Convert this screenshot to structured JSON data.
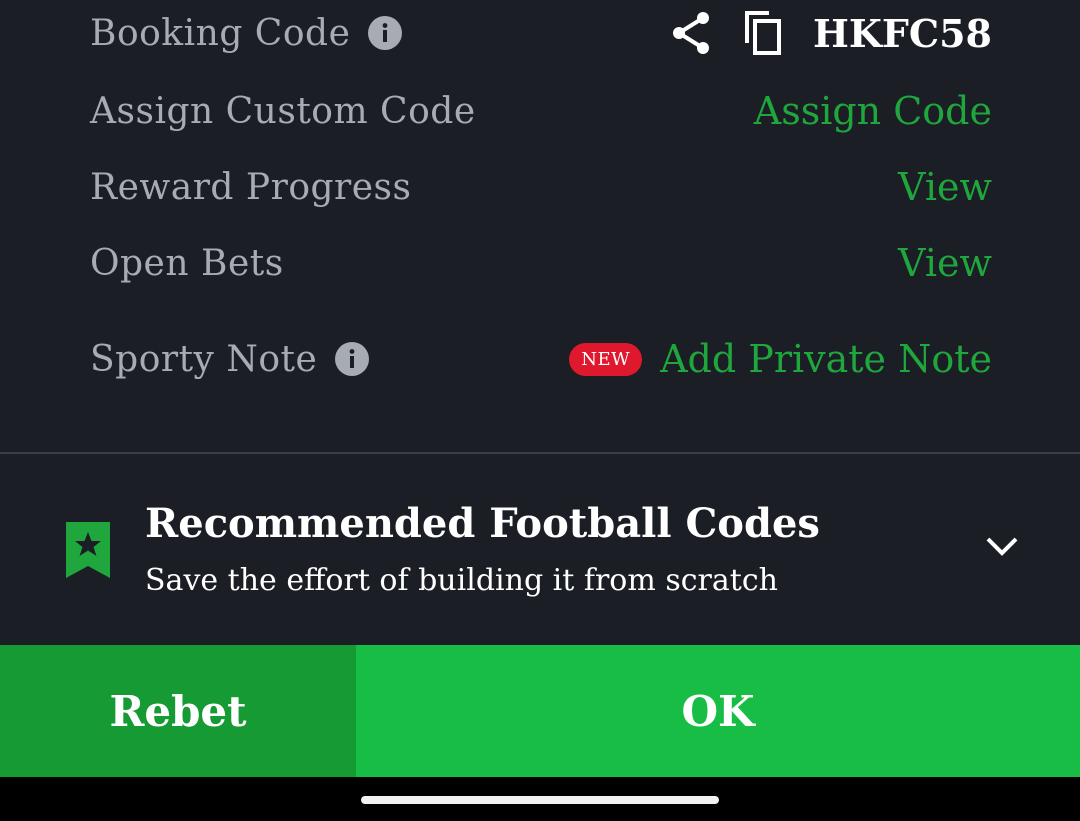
{
  "rows": {
    "booking_code": {
      "label": "Booking Code",
      "code": "HKFC58"
    },
    "assign_custom_code": {
      "label": "Assign Custom Code",
      "action": "Assign Code"
    },
    "reward_progress": {
      "label": "Reward Progress",
      "action": "View"
    },
    "open_bets": {
      "label": "Open Bets",
      "action": "View"
    },
    "sporty_note": {
      "label": "Sporty Note",
      "badge": "NEW",
      "action": "Add Private Note"
    }
  },
  "recommended": {
    "title": "Recommended Football Codes",
    "subtitle": "Save the effort of building it from scratch",
    "icon": "bookmark-star-icon"
  },
  "buttons": {
    "rebet": "Rebet",
    "ok": "OK"
  },
  "colors": {
    "background": "#1b1e25",
    "accent_green": "#1fa63d",
    "ok_button": "#18bd45",
    "rebet_button": "#159a34",
    "badge_red": "#e0182d"
  }
}
